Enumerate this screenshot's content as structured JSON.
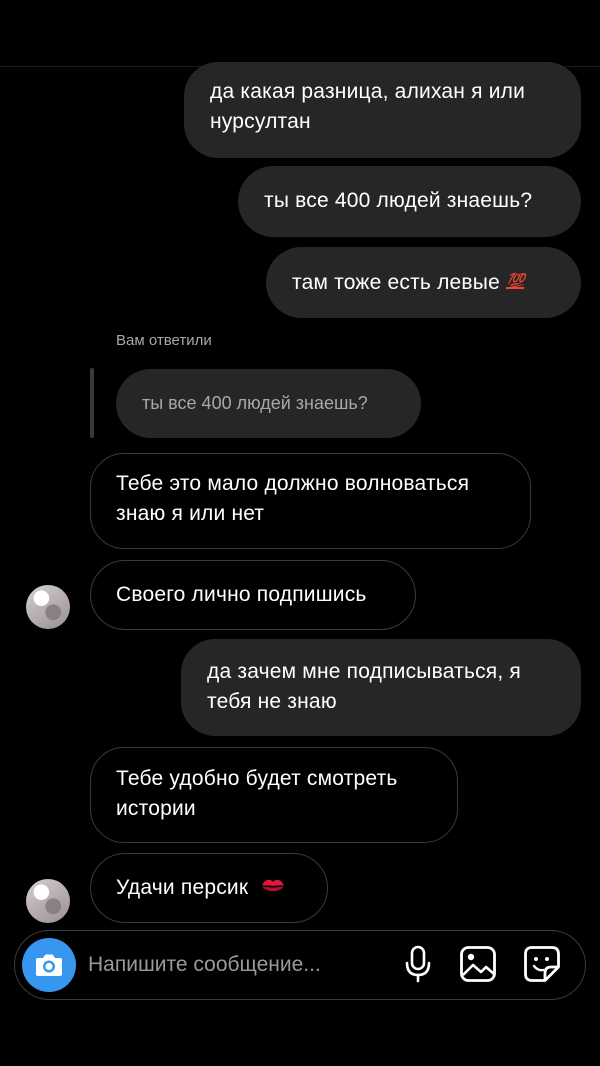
{
  "messages": [
    {
      "id": "m1",
      "direction": "outgoing",
      "lines": [
        "да какая разница, алихан я или",
        "нурсултан"
      ]
    },
    {
      "id": "m2",
      "direction": "outgoing",
      "lines": [
        "ты все 400 людей знаешь?"
      ]
    },
    {
      "id": "m3",
      "direction": "outgoing",
      "text": "там тоже есть левые",
      "emoji": "💯"
    },
    {
      "id": "m4",
      "direction": "incoming",
      "lines": [
        "Тебе это мало должно волноваться",
        "знаю я или нет"
      ]
    },
    {
      "id": "m5",
      "direction": "incoming",
      "lines": [
        "Своего лично подпишись"
      ]
    },
    {
      "id": "m6",
      "direction": "outgoing",
      "lines": [
        "да зачем мне подписываться, я",
        "тебя не знаю"
      ]
    },
    {
      "id": "m7",
      "direction": "incoming",
      "lines": [
        "Тебе удобно будет смотреть",
        "истории"
      ]
    },
    {
      "id": "m8",
      "direction": "incoming",
      "text": "Удачи персик",
      "emoji": "💋"
    }
  ],
  "reply": {
    "label": "Вам ответили",
    "quoted_text": "ты все 400 людей знаешь?"
  },
  "composer": {
    "placeholder": "Напишите сообщение...",
    "icons": [
      "camera-icon",
      "microphone-icon",
      "gallery-icon",
      "sticker-icon"
    ]
  },
  "colors": {
    "background": "#000000",
    "outgoing_bubble": "#262626",
    "incoming_border": "#3a3a3a",
    "camera_button": "#3797f0",
    "muted_text": "#a8a8a8"
  }
}
